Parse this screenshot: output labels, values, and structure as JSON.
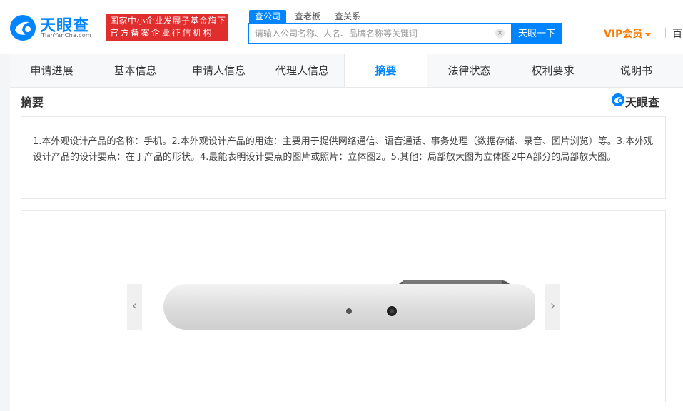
{
  "header": {
    "logo_text": "天眼查",
    "logo_sub": "TianYanCha.com",
    "badge_line1": "国家中小企业发展子基金旗下",
    "badge_line2": "官方备案企业征信机构",
    "search_tabs": [
      "查公司",
      "查老板",
      "查关系"
    ],
    "search_placeholder": "请输入公司名称、人名、品牌名称等关键词",
    "search_button": "天眼一下",
    "vip_label": "VIP会员",
    "more_nav": "百"
  },
  "tabs": [
    {
      "label": "申请进展"
    },
    {
      "label": "基本信息"
    },
    {
      "label": "申请人信息"
    },
    {
      "label": "代理人信息"
    },
    {
      "label": "摘要"
    },
    {
      "label": "法律状态"
    },
    {
      "label": "权利要求"
    },
    {
      "label": "说明书"
    }
  ],
  "active_tab": "摘要",
  "content": {
    "section_title": "摘要",
    "watermark": "天眼查",
    "abstract": "1.本外观设计产品的名称：手机。2.本外观设计产品的用途：主要用于提供网络通信、语音通话、事务处理（数据存储、录音、图片浏览）等。3.本外观设计产品的设计要点：在于产品的形状。4.最能表明设计要点的图片或照片：立体图2。5.其他：局部放大图为立体图2中A部分的局部放大图。",
    "prev_icon": "‹",
    "next_icon": "›"
  },
  "colors": {
    "brand": "#0084ff",
    "badge": "#e02d2d",
    "vip": "#ff7a00"
  },
  "icons": {
    "logo": "tianyancha-logo-icon",
    "clear": "clear-icon",
    "prev": "chevron-left-icon",
    "next": "chevron-right-icon"
  }
}
